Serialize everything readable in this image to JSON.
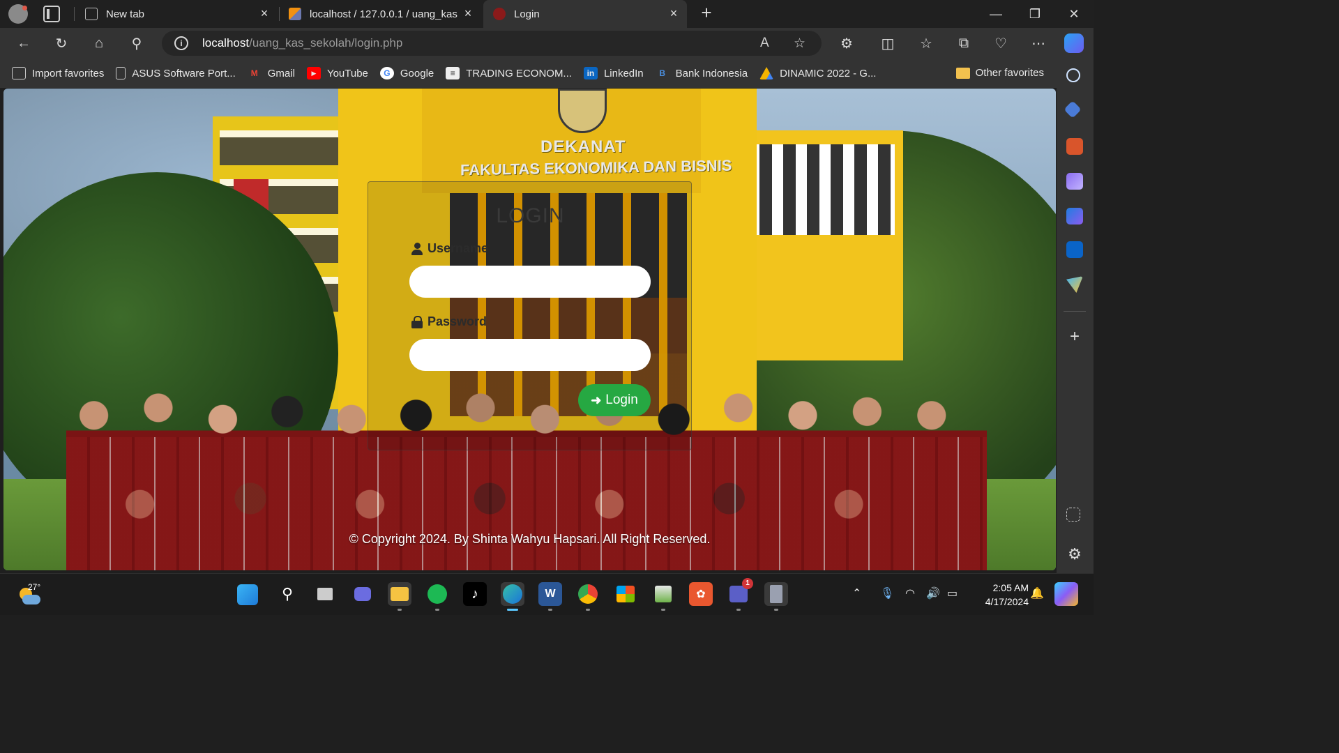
{
  "browser": {
    "tabs": [
      {
        "label": "New tab"
      },
      {
        "label": "localhost / 127.0.0.1 / uang_kas"
      },
      {
        "label": "Login"
      }
    ],
    "url_host": "localhost",
    "url_path": "/uang_kas_sekolah/login.php"
  },
  "favorites": {
    "items": [
      {
        "label": "Import favorites",
        "icon": "import-icon"
      },
      {
        "label": "ASUS Software Port...",
        "icon": "page-icon"
      },
      {
        "label": "Gmail",
        "icon": "gmail-icon"
      },
      {
        "label": "YouTube",
        "icon": "youtube-icon"
      },
      {
        "label": "Google",
        "icon": "google-icon"
      },
      {
        "label": "TRADING ECONOM...",
        "icon": "trading-economics-icon"
      },
      {
        "label": "LinkedIn",
        "icon": "linkedin-icon"
      },
      {
        "label": "Bank Indonesia",
        "icon": "bank-indonesia-icon"
      },
      {
        "label": "DINAMIC 2022 - G...",
        "icon": "google-drive-icon"
      }
    ],
    "other": "Other favorites"
  },
  "page": {
    "building_sign_1": "DEKANAT",
    "building_sign_2": "FAKULTAS EKONOMIKA DAN BISNIS",
    "login": {
      "title": "LOGIN",
      "username_label": "Username",
      "password_label": "Password",
      "button_label": "Login"
    },
    "copyright": "© Copyright 2024. By Shinta Wahyu Hapsari. All Right Reserved."
  },
  "taskbar": {
    "temperature": "27°",
    "time": "2:05 AM",
    "date": "4/17/2024",
    "teams_badge": "1"
  },
  "colors": {
    "login_button": "#26a842",
    "browser_chrome": "#333333"
  }
}
